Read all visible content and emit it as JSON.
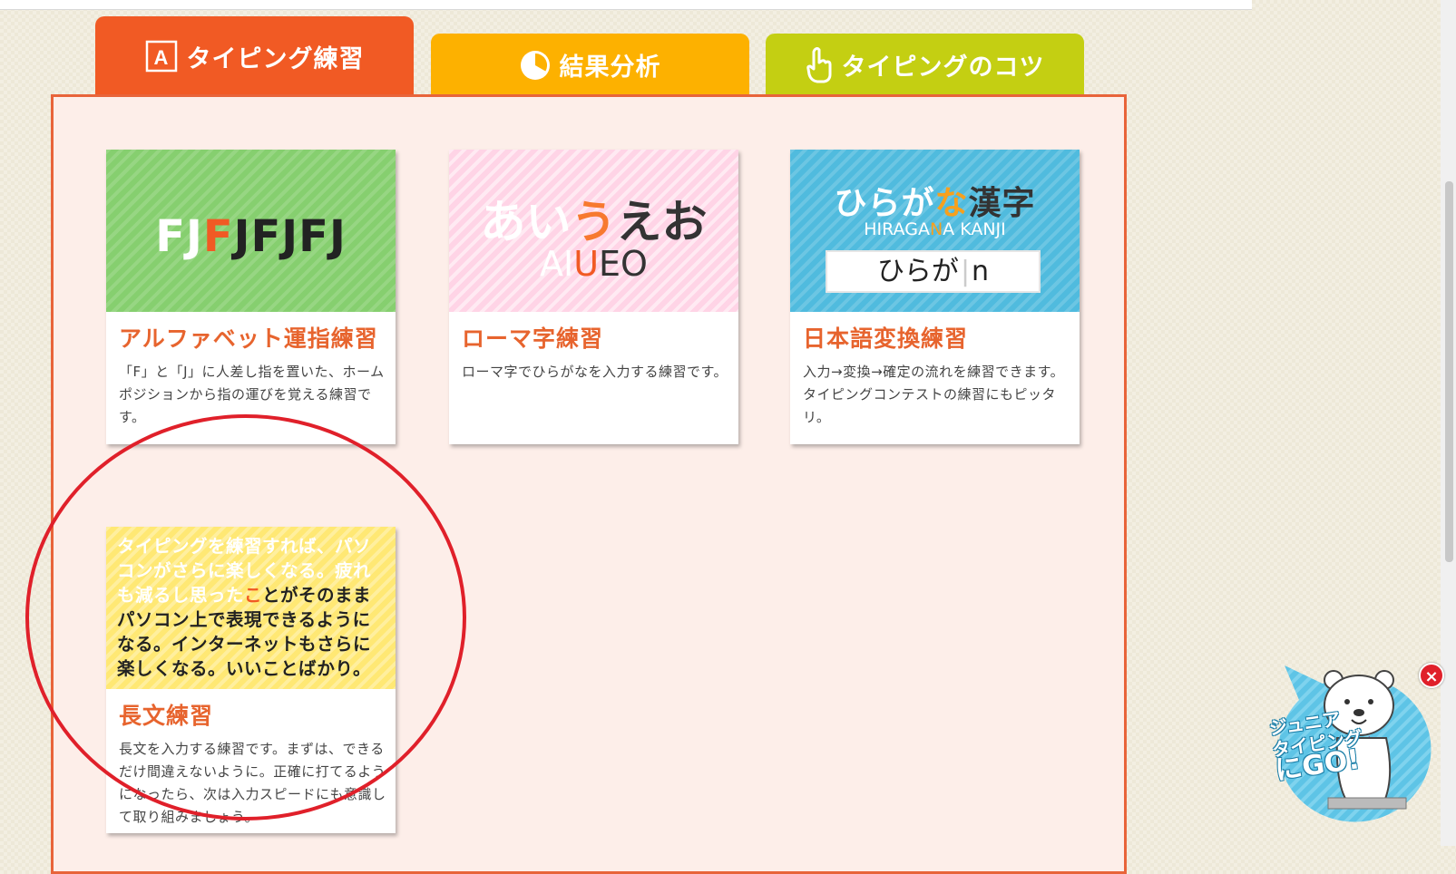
{
  "tabs": [
    {
      "label": "タイピング練習",
      "icon": "letter-a-icon",
      "color": "#f15a24"
    },
    {
      "label": "結果分析",
      "icon": "pie-chart-icon",
      "color": "#fdb100"
    },
    {
      "label": "タイピングのコツ",
      "icon": "pointing-hand-icon",
      "color": "#c4cf12"
    }
  ],
  "tab_icon_letter": "A",
  "cards": [
    {
      "title": "アルファベット運指練習",
      "desc": "「F」と「J」に人差し指を置いた、ホームポジションから指の運びを覚える練習です。",
      "hero": {
        "p1": "FJ",
        "p2": "F",
        "p3": "JFJFJ"
      }
    },
    {
      "title": "ローマ字練習",
      "desc": "ローマ字でひらがなを入力する練習です。",
      "hero": {
        "a1": "あい",
        "a2": "う",
        "a3": "えお",
        "r1": "AI",
        "r2": "U",
        "r3": "EO"
      }
    },
    {
      "title": "日本語変換練習",
      "desc": "入力→変換→確定の流れを練習できます。タイピングコンテストの練習にもピッタリ。",
      "hero": {
        "h1": "ひらが",
        "h2": "な",
        "h3": "漢字",
        "s1": "HIRAGA",
        "s2": "N",
        "s3": "A KANJI",
        "input_text": "ひらが",
        "cursor": "|",
        "input_char": "n"
      }
    },
    {
      "title": "長文練習",
      "desc": "長文を入力する練習です。まずは、できるだけ間違えないように。正確に打てるようになったら、次は入力スピードにも意識して取り組みましょう。",
      "hero": {
        "typed": "タイピングを練習すれば、パソコンがさらに楽しくなる。疲れも減るし思った",
        "current": "こ",
        "rest": "とがそのままパソコン上で表現できるようになる。インターネットもさらに楽しくなる。いいことばかり。"
      }
    }
  ],
  "badge": {
    "line1": "ジュニア",
    "line2": "タイピング",
    "line3": "にGO!",
    "close": "×"
  },
  "colors": {
    "accent": "#f15a24",
    "panel_bg": "#fdeee9",
    "title": "#e7642e",
    "circle": "#e0202a"
  }
}
